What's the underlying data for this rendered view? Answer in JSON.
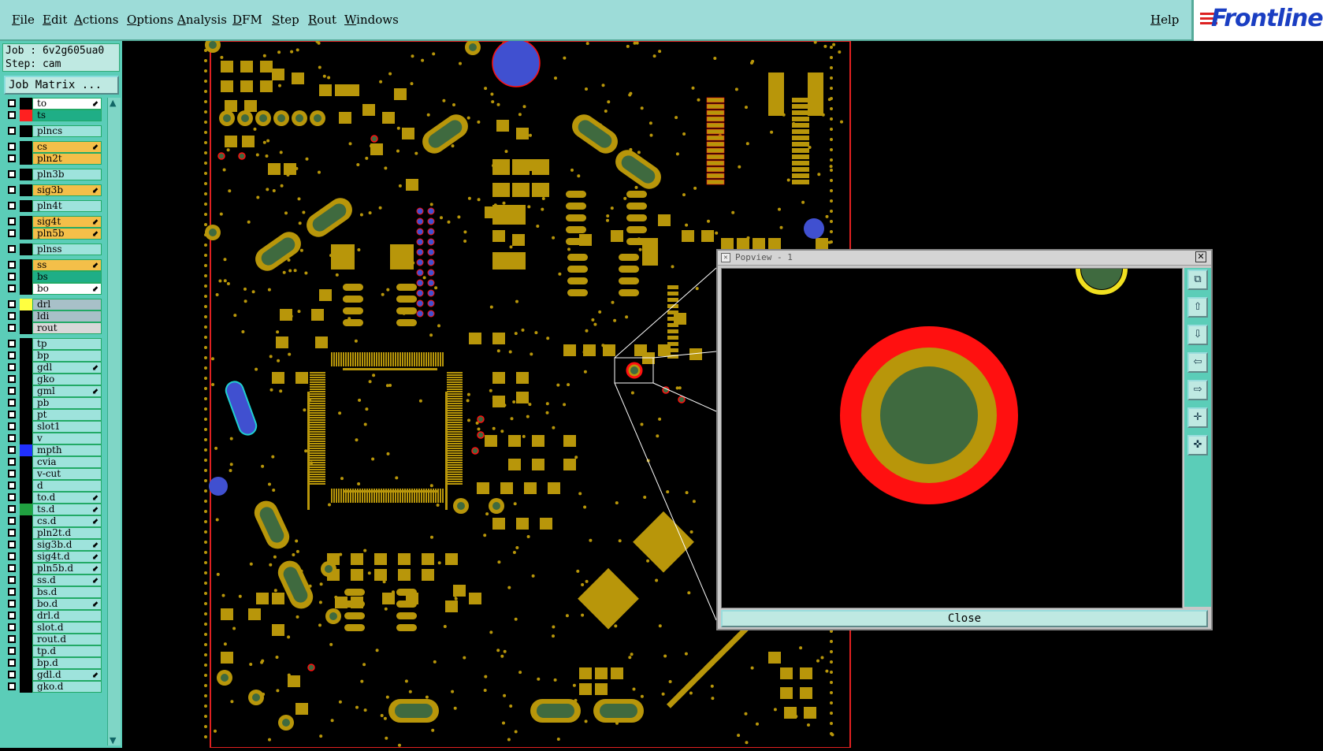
{
  "menu": {
    "items": [
      "File",
      "Edit",
      "Actions",
      "Options",
      "Analysis",
      "DFM",
      "Step",
      "Rout",
      "Windows"
    ],
    "help": "Help"
  },
  "logo": {
    "text": "Frontline"
  },
  "job": {
    "job_line": "Job : 6v2g605ua0",
    "step_line": "Step: cam",
    "matrix_button": "Job Matrix ..."
  },
  "layers": [
    {
      "name": "to",
      "color": "#ffffff",
      "swatch": "#000000",
      "arrow": true
    },
    {
      "name": "ts",
      "color": "#1fae86",
      "swatch": "#ff2020",
      "arrow": false
    },
    {
      "name": "plncs",
      "color": "#9ee3dc",
      "swatch": "#000000",
      "arrow": false
    },
    {
      "name": "cs",
      "color": "#f4bf49",
      "swatch": "#000000",
      "arrow": true
    },
    {
      "name": "pln2t",
      "color": "#f4bf49",
      "swatch": "#000000",
      "arrow": false
    },
    {
      "name": "pln3b",
      "color": "#9ee3dc",
      "swatch": "#000000",
      "arrow": false
    },
    {
      "name": "sig3b",
      "color": "#f4bf49",
      "swatch": "#000000",
      "arrow": true
    },
    {
      "name": "pln4t",
      "color": "#9ee3dc",
      "swatch": "#000000",
      "arrow": false
    },
    {
      "name": "sig4t",
      "color": "#f4bf49",
      "swatch": "#000000",
      "arrow": true
    },
    {
      "name": "pln5b",
      "color": "#f4bf49",
      "swatch": "#000000",
      "arrow": true
    },
    {
      "name": "plnss",
      "color": "#9ee3dc",
      "swatch": "#000000",
      "arrow": false
    },
    {
      "name": "ss",
      "color": "#f4bf49",
      "swatch": "#000000",
      "arrow": true
    },
    {
      "name": "bs",
      "color": "#1fae86",
      "swatch": "#000000",
      "arrow": false
    },
    {
      "name": "bo",
      "color": "#ffffff",
      "swatch": "#000000",
      "arrow": true
    },
    {
      "name": "drl",
      "color": "#a8c0c8",
      "swatch": "#ffff40",
      "arrow": false
    },
    {
      "name": "ldi",
      "color": "#a8c0c8",
      "swatch": "#000000",
      "arrow": false
    },
    {
      "name": "rout",
      "color": "#d8d8d8",
      "swatch": "#000000",
      "arrow": false
    },
    {
      "name": "tp",
      "color": "#9ee3dc",
      "swatch": "#000000",
      "arrow": false
    },
    {
      "name": "bp",
      "color": "#9ee3dc",
      "swatch": "#000000",
      "arrow": false
    },
    {
      "name": "gdl",
      "color": "#9ee3dc",
      "swatch": "#000000",
      "arrow": true
    },
    {
      "name": "gko",
      "color": "#9ee3dc",
      "swatch": "#000000",
      "arrow": false
    },
    {
      "name": "gml",
      "color": "#9ee3dc",
      "swatch": "#000000",
      "arrow": true
    },
    {
      "name": "pb",
      "color": "#9ee3dc",
      "swatch": "#000000",
      "arrow": false
    },
    {
      "name": "pt",
      "color": "#9ee3dc",
      "swatch": "#000000",
      "arrow": false
    },
    {
      "name": "slot1",
      "color": "#9ee3dc",
      "swatch": "#000000",
      "arrow": false
    },
    {
      "name": "v",
      "color": "#9ee3dc",
      "swatch": "#000000",
      "arrow": false
    },
    {
      "name": "mpth",
      "color": "#9ee3dc",
      "swatch": "#2030ff",
      "arrow": false
    },
    {
      "name": "cvia",
      "color": "#9ee3dc",
      "swatch": "#000000",
      "arrow": false
    },
    {
      "name": "v-cut",
      "color": "#9ee3dc",
      "swatch": "#000000",
      "arrow": false
    },
    {
      "name": "d",
      "color": "#9ee3dc",
      "swatch": "#000000",
      "arrow": false
    },
    {
      "name": "to.d",
      "color": "#9ee3dc",
      "swatch": "#000000",
      "arrow": true
    },
    {
      "name": "ts.d",
      "color": "#9ee3dc",
      "swatch": "#20a040",
      "arrow": true
    },
    {
      "name": "cs.d",
      "color": "#9ee3dc",
      "swatch": "#000000",
      "arrow": true
    },
    {
      "name": "pln2t.d",
      "color": "#9ee3dc",
      "swatch": "#000000",
      "arrow": false
    },
    {
      "name": "sig3b.d",
      "color": "#9ee3dc",
      "swatch": "#000000",
      "arrow": true
    },
    {
      "name": "sig4t.d",
      "color": "#9ee3dc",
      "swatch": "#000000",
      "arrow": true
    },
    {
      "name": "pln5b.d",
      "color": "#9ee3dc",
      "swatch": "#000000",
      "arrow": true
    },
    {
      "name": "ss.d",
      "color": "#9ee3dc",
      "swatch": "#000000",
      "arrow": true
    },
    {
      "name": "bs.d",
      "color": "#9ee3dc",
      "swatch": "#000000",
      "arrow": false
    },
    {
      "name": "bo.d",
      "color": "#9ee3dc",
      "swatch": "#000000",
      "arrow": true
    },
    {
      "name": "drl.d",
      "color": "#9ee3dc",
      "swatch": "#000000",
      "arrow": false
    },
    {
      "name": "slot.d",
      "color": "#9ee3dc",
      "swatch": "#000000",
      "arrow": false
    },
    {
      "name": "rout.d",
      "color": "#9ee3dc",
      "swatch": "#000000",
      "arrow": false
    },
    {
      "name": "tp.d",
      "color": "#9ee3dc",
      "swatch": "#000000",
      "arrow": false
    },
    {
      "name": "bp.d",
      "color": "#9ee3dc",
      "swatch": "#000000",
      "arrow": false
    },
    {
      "name": "gdl.d",
      "color": "#9ee3dc",
      "swatch": "#000000",
      "arrow": true
    },
    {
      "name": "gko.d",
      "color": "#9ee3dc",
      "swatch": "#000000",
      "arrow": false
    }
  ],
  "popup": {
    "title": "Popview - 1",
    "close_label": "Close",
    "tools": [
      "zoom-fit-icon",
      "pan-up-icon",
      "pan-down-icon",
      "pan-left-icon",
      "pan-right-icon",
      "zoom-in-icon",
      "zoom-out-icon"
    ]
  },
  "colors": {
    "menu_bg": "#9ddcd8",
    "pad_gold": "#b8960a",
    "pad_green": "#3f6a3f",
    "via_blue": "#4050d0",
    "mask_red": "#ff1010",
    "board_outline": "#e02020"
  }
}
